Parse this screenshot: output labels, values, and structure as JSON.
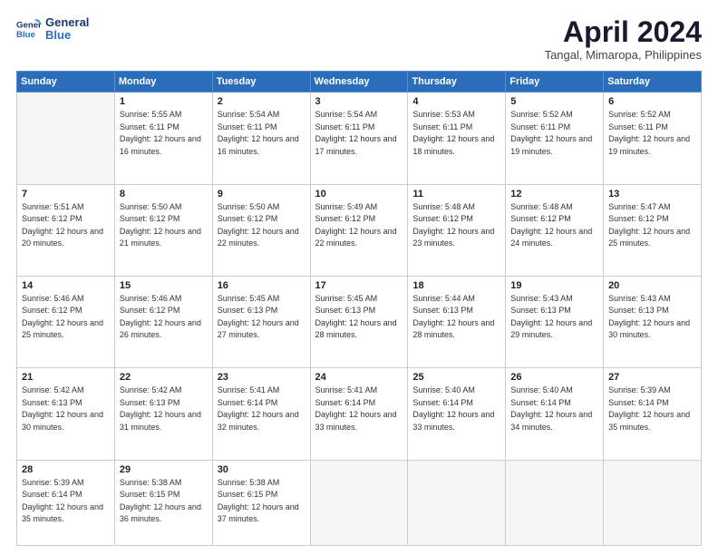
{
  "header": {
    "logo_line1": "General",
    "logo_line2": "Blue",
    "month": "April 2024",
    "location": "Tangal, Mimaropa, Philippines"
  },
  "weekdays": [
    "Sunday",
    "Monday",
    "Tuesday",
    "Wednesday",
    "Thursday",
    "Friday",
    "Saturday"
  ],
  "weeks": [
    [
      {
        "day": null
      },
      {
        "day": "1",
        "sunrise": "5:55 AM",
        "sunset": "6:11 PM",
        "daylight": "12 hours and 16 minutes."
      },
      {
        "day": "2",
        "sunrise": "5:54 AM",
        "sunset": "6:11 PM",
        "daylight": "12 hours and 16 minutes."
      },
      {
        "day": "3",
        "sunrise": "5:54 AM",
        "sunset": "6:11 PM",
        "daylight": "12 hours and 17 minutes."
      },
      {
        "day": "4",
        "sunrise": "5:53 AM",
        "sunset": "6:11 PM",
        "daylight": "12 hours and 18 minutes."
      },
      {
        "day": "5",
        "sunrise": "5:52 AM",
        "sunset": "6:11 PM",
        "daylight": "12 hours and 19 minutes."
      },
      {
        "day": "6",
        "sunrise": "5:52 AM",
        "sunset": "6:11 PM",
        "daylight": "12 hours and 19 minutes."
      }
    ],
    [
      {
        "day": "7",
        "sunrise": "5:51 AM",
        "sunset": "6:12 PM",
        "daylight": "12 hours and 20 minutes."
      },
      {
        "day": "8",
        "sunrise": "5:50 AM",
        "sunset": "6:12 PM",
        "daylight": "12 hours and 21 minutes."
      },
      {
        "day": "9",
        "sunrise": "5:50 AM",
        "sunset": "6:12 PM",
        "daylight": "12 hours and 22 minutes."
      },
      {
        "day": "10",
        "sunrise": "5:49 AM",
        "sunset": "6:12 PM",
        "daylight": "12 hours and 22 minutes."
      },
      {
        "day": "11",
        "sunrise": "5:48 AM",
        "sunset": "6:12 PM",
        "daylight": "12 hours and 23 minutes."
      },
      {
        "day": "12",
        "sunrise": "5:48 AM",
        "sunset": "6:12 PM",
        "daylight": "12 hours and 24 minutes."
      },
      {
        "day": "13",
        "sunrise": "5:47 AM",
        "sunset": "6:12 PM",
        "daylight": "12 hours and 25 minutes."
      }
    ],
    [
      {
        "day": "14",
        "sunrise": "5:46 AM",
        "sunset": "6:12 PM",
        "daylight": "12 hours and 25 minutes."
      },
      {
        "day": "15",
        "sunrise": "5:46 AM",
        "sunset": "6:12 PM",
        "daylight": "12 hours and 26 minutes."
      },
      {
        "day": "16",
        "sunrise": "5:45 AM",
        "sunset": "6:13 PM",
        "daylight": "12 hours and 27 minutes."
      },
      {
        "day": "17",
        "sunrise": "5:45 AM",
        "sunset": "6:13 PM",
        "daylight": "12 hours and 28 minutes."
      },
      {
        "day": "18",
        "sunrise": "5:44 AM",
        "sunset": "6:13 PM",
        "daylight": "12 hours and 28 minutes."
      },
      {
        "day": "19",
        "sunrise": "5:43 AM",
        "sunset": "6:13 PM",
        "daylight": "12 hours and 29 minutes."
      },
      {
        "day": "20",
        "sunrise": "5:43 AM",
        "sunset": "6:13 PM",
        "daylight": "12 hours and 30 minutes."
      }
    ],
    [
      {
        "day": "21",
        "sunrise": "5:42 AM",
        "sunset": "6:13 PM",
        "daylight": "12 hours and 30 minutes."
      },
      {
        "day": "22",
        "sunrise": "5:42 AM",
        "sunset": "6:13 PM",
        "daylight": "12 hours and 31 minutes."
      },
      {
        "day": "23",
        "sunrise": "5:41 AM",
        "sunset": "6:14 PM",
        "daylight": "12 hours and 32 minutes."
      },
      {
        "day": "24",
        "sunrise": "5:41 AM",
        "sunset": "6:14 PM",
        "daylight": "12 hours and 33 minutes."
      },
      {
        "day": "25",
        "sunrise": "5:40 AM",
        "sunset": "6:14 PM",
        "daylight": "12 hours and 33 minutes."
      },
      {
        "day": "26",
        "sunrise": "5:40 AM",
        "sunset": "6:14 PM",
        "daylight": "12 hours and 34 minutes."
      },
      {
        "day": "27",
        "sunrise": "5:39 AM",
        "sunset": "6:14 PM",
        "daylight": "12 hours and 35 minutes."
      }
    ],
    [
      {
        "day": "28",
        "sunrise": "5:39 AM",
        "sunset": "6:14 PM",
        "daylight": "12 hours and 35 minutes."
      },
      {
        "day": "29",
        "sunrise": "5:38 AM",
        "sunset": "6:15 PM",
        "daylight": "12 hours and 36 minutes."
      },
      {
        "day": "30",
        "sunrise": "5:38 AM",
        "sunset": "6:15 PM",
        "daylight": "12 hours and 37 minutes."
      },
      {
        "day": null
      },
      {
        "day": null
      },
      {
        "day": null
      },
      {
        "day": null
      }
    ]
  ]
}
